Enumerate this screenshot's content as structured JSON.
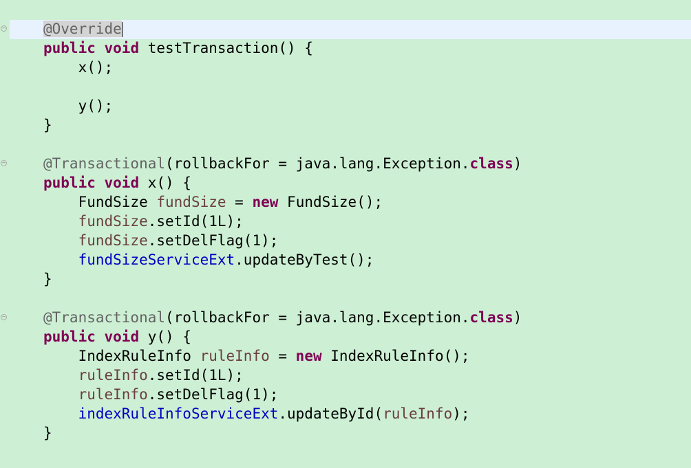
{
  "editor": {
    "lines": [
      [
        {
          "t": "@Override",
          "c": "ann-sel",
          "n": "annotation-override"
        },
        {
          "t": "",
          "c": "caret",
          "n": "text-caret"
        }
      ],
      [
        {
          "t": "public",
          "c": "kw"
        },
        {
          "t": " "
        },
        {
          "t": "void",
          "c": "kw"
        },
        {
          "t": " testTransaction() {"
        }
      ],
      [
        {
          "t": "    x();"
        }
      ],
      [
        {
          "t": ""
        }
      ],
      [
        {
          "t": "    y();"
        }
      ],
      [
        {
          "t": "}"
        }
      ],
      [
        {
          "t": ""
        }
      ],
      [
        {
          "t": "@Transactional",
          "c": "ann"
        },
        {
          "t": "(rollbackFor = java.lang.Exception."
        },
        {
          "t": "class",
          "c": "kw"
        },
        {
          "t": ")"
        }
      ],
      [
        {
          "t": "public",
          "c": "kw"
        },
        {
          "t": " "
        },
        {
          "t": "void",
          "c": "kw"
        },
        {
          "t": " x() {"
        }
      ],
      [
        {
          "t": "    FundSize "
        },
        {
          "t": "fundSize",
          "c": "var"
        },
        {
          "t": " = "
        },
        {
          "t": "new",
          "c": "kw"
        },
        {
          "t": " FundSize();"
        }
      ],
      [
        {
          "t": "    "
        },
        {
          "t": "fundSize",
          "c": "var"
        },
        {
          "t": ".setId(1L);"
        }
      ],
      [
        {
          "t": "    "
        },
        {
          "t": "fundSize",
          "c": "var"
        },
        {
          "t": ".setDelFlag(1);"
        }
      ],
      [
        {
          "t": "    "
        },
        {
          "t": "fundSizeServiceExt",
          "c": "fld"
        },
        {
          "t": ".updateByTest();"
        }
      ],
      [
        {
          "t": "}"
        }
      ],
      [
        {
          "t": ""
        }
      ],
      [
        {
          "t": "@Transactional",
          "c": "ann"
        },
        {
          "t": "(rollbackFor = java.lang.Exception."
        },
        {
          "t": "class",
          "c": "kw"
        },
        {
          "t": ")"
        }
      ],
      [
        {
          "t": "public",
          "c": "kw"
        },
        {
          "t": " "
        },
        {
          "t": "void",
          "c": "kw"
        },
        {
          "t": " y() {"
        }
      ],
      [
        {
          "t": "    IndexRuleInfo "
        },
        {
          "t": "ruleInfo",
          "c": "var"
        },
        {
          "t": " = "
        },
        {
          "t": "new",
          "c": "kw"
        },
        {
          "t": " IndexRuleInfo();"
        }
      ],
      [
        {
          "t": "    "
        },
        {
          "t": "ruleInfo",
          "c": "var"
        },
        {
          "t": ".setId(1L);"
        }
      ],
      [
        {
          "t": "    "
        },
        {
          "t": "ruleInfo",
          "c": "var"
        },
        {
          "t": ".setDelFlag(1);"
        }
      ],
      [
        {
          "t": "    "
        },
        {
          "t": "indexRuleInfoServiceExt",
          "c": "fld"
        },
        {
          "t": ".updateById("
        },
        {
          "t": "ruleInfo",
          "c": "var"
        },
        {
          "t": ");"
        }
      ],
      [
        {
          "t": "}"
        }
      ]
    ],
    "fold_markers": [
      {
        "line": 0,
        "symbol": "−"
      },
      {
        "line": 7,
        "symbol": "−"
      },
      {
        "line": 15,
        "symbol": "−"
      }
    ],
    "colors": {
      "background": "#cdefd4",
      "current_line": "#e8f2fe",
      "keyword": "#7f0055",
      "annotation": "#646464",
      "local_variable": "#6a3e3e",
      "field": "#0000c0"
    }
  }
}
